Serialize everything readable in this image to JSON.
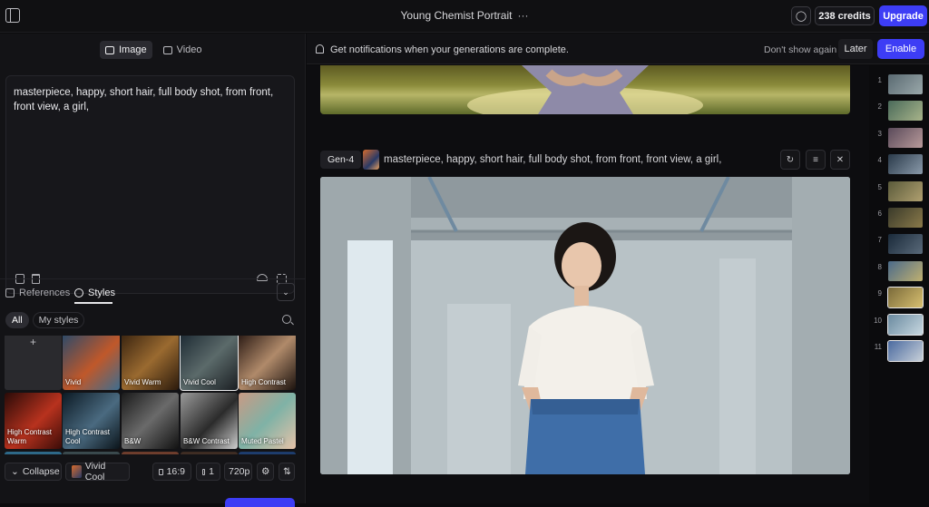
{
  "header": {
    "title": "Young Chemist Portrait",
    "more_glyph": "···",
    "credits": "238 credits",
    "upgrade": "Upgrade"
  },
  "left_panel": {
    "mode_tabs": [
      {
        "label": "Image",
        "active": true,
        "icon": "image-icon"
      },
      {
        "label": "Video",
        "active": false,
        "icon": "video-icon"
      }
    ],
    "prompt_text": "masterpiece, happy, short hair, full body shot, from front, front view, a girl,",
    "section_tabs": [
      {
        "label": "References",
        "active": false
      },
      {
        "label": "Styles",
        "active": true
      }
    ],
    "filters": [
      "All",
      "My styles"
    ],
    "styles": [
      {
        "label": "+",
        "bg": "#2a2a2e"
      },
      {
        "label": "Vivid",
        "bg": "linear-gradient(135deg,#2b4a6a,#c0582a 55%,#3e6d8f)"
      },
      {
        "label": "Vivid Warm",
        "bg": "linear-gradient(135deg,#3a2410,#9a6a30 50%,#2b1a0c)"
      },
      {
        "label": "Vivid Cool",
        "bg": "linear-gradient(135deg,#1d2a33,#5b6a6a 50%,#1a1e22)",
        "selected": true
      },
      {
        "label": "High Contrast",
        "bg": "linear-gradient(135deg,#2a1a14,#b08a6a 50%,#1b120e)"
      },
      {
        "label": "High Contrast Warm",
        "bg": "linear-gradient(135deg,#2a0b08,#b8321e 55%,#3a0c08)"
      },
      {
        "label": "High Contrast Cool",
        "bg": "linear-gradient(135deg,#0c1a24,#4a6a80 55%,#0b141a)"
      },
      {
        "label": "B&W",
        "bg": "linear-gradient(135deg,#1a1a1a,#6a6a6a 50%,#111)"
      },
      {
        "label": "B&W Contrast",
        "bg": "linear-gradient(135deg,#9a9a9a,#2b2b2b 55%,#cfcfcf)"
      },
      {
        "label": "Muted Pastel",
        "bg": "linear-gradient(135deg,#c99a84,#7fb2a6 50%,#e6c2a8)"
      },
      {
        "label": "",
        "bg": "linear-gradient(180deg,#2e6a8a,#1c4860 60%,#0c2434)"
      },
      {
        "label": "",
        "bg": "linear-gradient(180deg,#3a4a4e,#1e2a2c)"
      },
      {
        "label": "",
        "bg": "linear-gradient(180deg,#6a3a2a,#b27a5a 60%,#3a2014)"
      },
      {
        "label": "",
        "bg": "linear-gradient(180deg,#3a2a22,#9a5a3a 60%,#1e140e)"
      },
      {
        "label": "",
        "bg": "linear-gradient(180deg,#1c3a6a,#3a6aa0 60%,#0c1a30)"
      }
    ],
    "controls": {
      "collapse": "Collapse",
      "style": "Vivid Cool",
      "aspect": "16:9",
      "count": "1",
      "resolution": "720p"
    }
  },
  "notification": {
    "message": "Get notifications when your generations are complete.",
    "dont_show": "Don't show again",
    "later": "Later",
    "enable": "Enable"
  },
  "generation": {
    "model": "Gen-4",
    "prompt": "masterpiece, happy, short hair, full body shot, from front, front view, a girl,"
  },
  "rail": {
    "items": [
      {
        "n": "1",
        "bg": "linear-gradient(135deg,#5a6a72,#9aa8aa)"
      },
      {
        "n": "2",
        "bg": "linear-gradient(135deg,#4a6a5a,#a8b48a)"
      },
      {
        "n": "3",
        "bg": "linear-gradient(135deg,#5a4a5a,#b89a9a)"
      },
      {
        "n": "4",
        "bg": "linear-gradient(135deg,#2a3a4a,#8a9aaa)"
      },
      {
        "n": "5",
        "bg": "linear-gradient(135deg,#5a5a3a,#b0a070)"
      },
      {
        "n": "6",
        "bg": "linear-gradient(135deg,#3a3a2a,#8a7a4a)"
      },
      {
        "n": "7",
        "bg": "linear-gradient(135deg,#1a2a3a,#5a6a7a)"
      },
      {
        "n": "8",
        "bg": "linear-gradient(135deg,#4a6a8a,#c0b070)"
      },
      {
        "n": "9",
        "bg": "linear-gradient(135deg,#7a6a3a,#d8c070)",
        "selected": true
      },
      {
        "n": "10",
        "bg": "linear-gradient(135deg,#6a8aa0,#c8d8e0)",
        "selected": true
      },
      {
        "n": "11",
        "bg": "linear-gradient(135deg,#4a6aa0,#c8d0d8)",
        "selected": true
      }
    ]
  },
  "colors": {
    "accent": "#3d3df5",
    "background": "#0b0b0d",
    "panel": "#131316"
  }
}
